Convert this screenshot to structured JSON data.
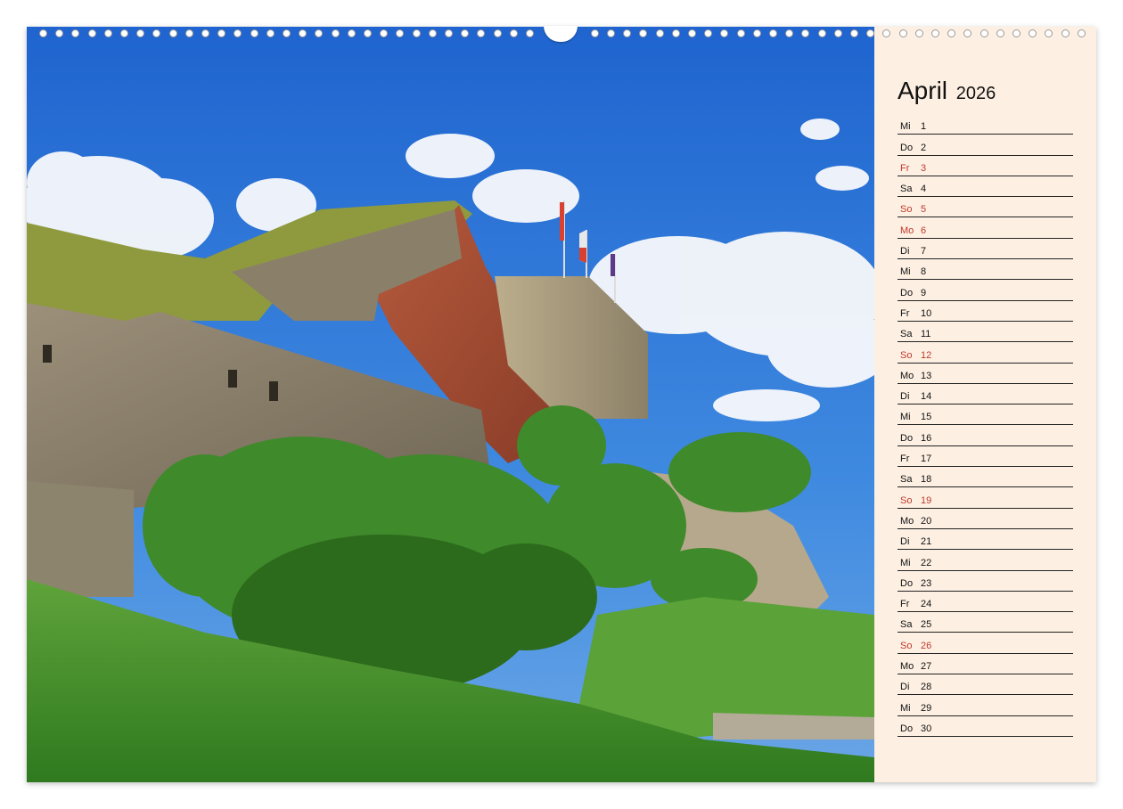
{
  "calendar": {
    "month": "April",
    "year": "2026",
    "days": [
      {
        "dow": "Mi",
        "day": "1",
        "holiday": false
      },
      {
        "dow": "Do",
        "day": "2",
        "holiday": false
      },
      {
        "dow": "Fr",
        "day": "3",
        "holiday": true
      },
      {
        "dow": "Sa",
        "day": "4",
        "holiday": false
      },
      {
        "dow": "So",
        "day": "5",
        "holiday": true
      },
      {
        "dow": "Mo",
        "day": "6",
        "holiday": true
      },
      {
        "dow": "Di",
        "day": "7",
        "holiday": false
      },
      {
        "dow": "Mi",
        "day": "8",
        "holiday": false
      },
      {
        "dow": "Do",
        "day": "9",
        "holiday": false
      },
      {
        "dow": "Fr",
        "day": "10",
        "holiday": false
      },
      {
        "dow": "Sa",
        "day": "11",
        "holiday": false
      },
      {
        "dow": "So",
        "day": "12",
        "holiday": true
      },
      {
        "dow": "Mo",
        "day": "13",
        "holiday": false
      },
      {
        "dow": "Di",
        "day": "14",
        "holiday": false
      },
      {
        "dow": "Mi",
        "day": "15",
        "holiday": false
      },
      {
        "dow": "Do",
        "day": "16",
        "holiday": false
      },
      {
        "dow": "Fr",
        "day": "17",
        "holiday": false
      },
      {
        "dow": "Sa",
        "day": "18",
        "holiday": false
      },
      {
        "dow": "So",
        "day": "19",
        "holiday": true
      },
      {
        "dow": "Mo",
        "day": "20",
        "holiday": false
      },
      {
        "dow": "Di",
        "day": "21",
        "holiday": false
      },
      {
        "dow": "Mi",
        "day": "22",
        "holiday": false
      },
      {
        "dow": "Do",
        "day": "23",
        "holiday": false
      },
      {
        "dow": "Fr",
        "day": "24",
        "holiday": false
      },
      {
        "dow": "Sa",
        "day": "25",
        "holiday": false
      },
      {
        "dow": "So",
        "day": "26",
        "holiday": true
      },
      {
        "dow": "Mo",
        "day": "27",
        "holiday": false
      },
      {
        "dow": "Di",
        "day": "28",
        "holiday": false
      },
      {
        "dow": "Mi",
        "day": "29",
        "holiday": false
      },
      {
        "dow": "Do",
        "day": "30",
        "holiday": false
      }
    ]
  },
  "colors": {
    "holiday": "#c0392b",
    "panel": "#fdf0e3",
    "sky": "#2f78d8"
  }
}
